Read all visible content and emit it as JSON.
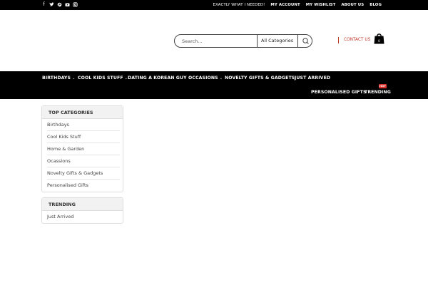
{
  "topbar": {
    "social": [
      "facebook-icon",
      "twitter-icon",
      "pinterest-icon",
      "youtube-icon",
      "instagram-icon"
    ],
    "links": [
      "EXACTLY WHAT I NEEDED!",
      "MY ACCOUNT",
      "MY WISHLIST",
      "ABOUT US",
      "BLOG"
    ]
  },
  "header": {
    "search_placeholder": "Search...",
    "category_selected": "All Categories",
    "contact_label": "CONTACT US",
    "cart_count": "0"
  },
  "nav": {
    "items": [
      "BIRTHDAYS",
      "COOL KIDS STUFF",
      "DATING A KOREAN GUY",
      "OCCASIONS",
      "NOVELTY GIFTS & GADGETS",
      "JUST ARRIVED",
      "PERSONALISED GIFTS",
      "TRENDING"
    ],
    "hot_badge": "HOT"
  },
  "sidebar": {
    "top_categories": {
      "title": "TOP CATEGORIES",
      "items": [
        "Birthdays",
        "Cool Kids Stuff",
        "Home & Garden",
        "Ocassions",
        "Novelty Gifts & Gadgets",
        "Personalised Gifts"
      ]
    },
    "trending": {
      "title": "TRENDING",
      "items": [
        "Just Arrived"
      ]
    }
  },
  "colors": {
    "bar": "#000000",
    "accent": "#c0392b",
    "hot": "#d9312b"
  }
}
